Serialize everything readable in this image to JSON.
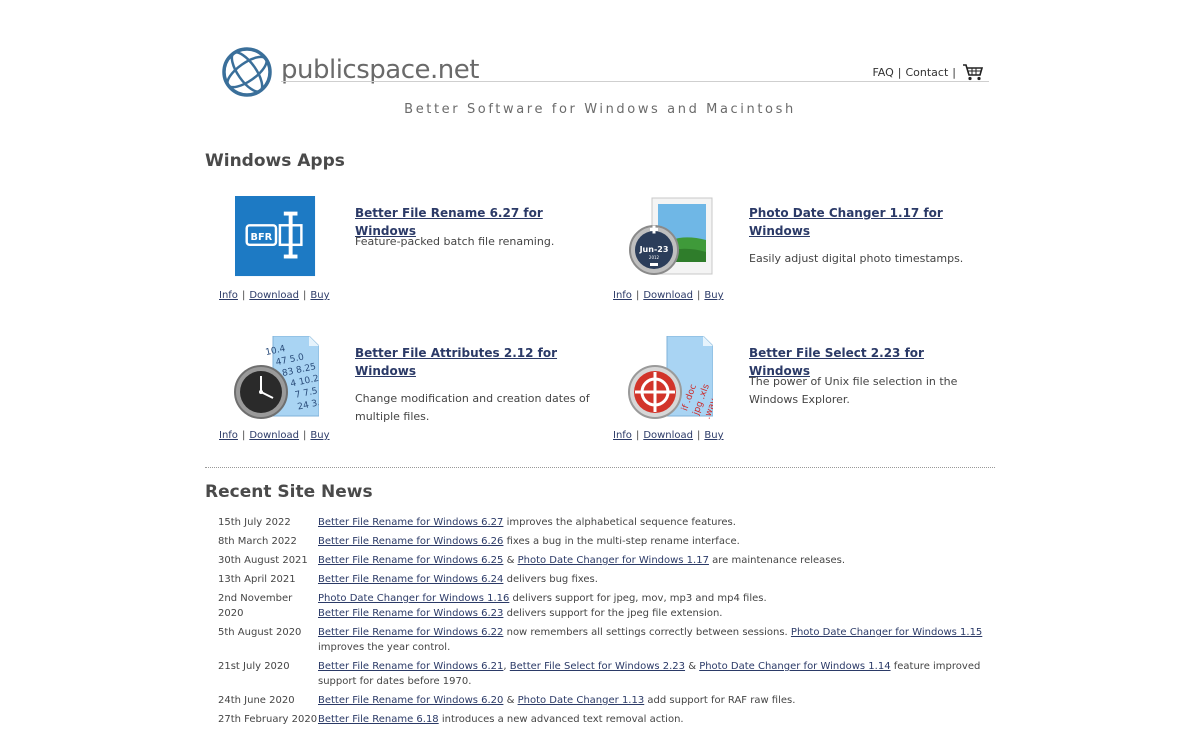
{
  "header": {
    "brand": "publicspace.net",
    "tagline": "Better Software for Windows and Macintosh",
    "nav": {
      "faq": "FAQ",
      "contact": "Contact",
      "sep": "|"
    }
  },
  "windows_apps": {
    "title": "Windows Apps",
    "apps": [
      {
        "name": "Better File Rename 6.27 for Windows",
        "desc": "Feature-packed batch file renaming.",
        "icon": "bfr-icon",
        "badge": "BFR"
      },
      {
        "name": "Photo Date Changer 1.17 for Windows",
        "desc": "Easily adjust digital photo timestamps.",
        "icon": "photo-date-changer-icon",
        "badge": "Jun-23",
        "badge_year": "2012"
      },
      {
        "name": "Better File Attributes 2.12 for Windows",
        "desc": "Change modification and creation dates of multiple files.",
        "icon": "clock-document-icon"
      },
      {
        "name": "Better File Select 2.23 for Windows",
        "desc": "The power of Unix file selection in the Windows Explorer.",
        "icon": "crosshair-document-icon"
      }
    ],
    "links": {
      "info": "Info",
      "download": "Download",
      "buy": "Buy",
      "sep": "|"
    }
  },
  "news": {
    "title": "Recent Site News",
    "items": [
      {
        "date": "15th July 2022",
        "segments": [
          {
            "link": "Better File Rename for Windows 6.27"
          },
          {
            "text": " improves the alphabetical sequence features."
          }
        ]
      },
      {
        "date": "8th March 2022",
        "segments": [
          {
            "link": "Better File Rename for Windows 6.26"
          },
          {
            "text": " fixes a bug in the multi-step rename interface."
          }
        ]
      },
      {
        "date": "30th August 2021",
        "segments": [
          {
            "link": "Better File Rename for Windows 6.25"
          },
          {
            "text": " & "
          },
          {
            "link": "Photo Date Changer for Windows 1.17"
          },
          {
            "text": " are maintenance releases."
          }
        ]
      },
      {
        "date": "13th April 2021",
        "segments": [
          {
            "link": "Better File Rename for Windows 6.24"
          },
          {
            "text": " delivers bug fixes."
          }
        ]
      },
      {
        "date": "2nd November 2020",
        "segments": [
          {
            "link": "Photo Date Changer for Windows 1.16"
          },
          {
            "text": " delivers support for jpeg, mov, mp3 and mp4 files."
          },
          {
            "br": true
          },
          {
            "link": "Better File Rename for Windows 6.23"
          },
          {
            "text": " delivers support for the jpeg file extension."
          }
        ]
      },
      {
        "date": "5th August 2020",
        "segments": [
          {
            "link": "Better File Rename for Windows 6.22"
          },
          {
            "text": " now remembers all settings correctly between sessions. "
          },
          {
            "link": "Photo Date Changer for Windows 1.15"
          },
          {
            "text": " improves the year control."
          }
        ]
      },
      {
        "date": "21st July 2020",
        "segments": [
          {
            "link": "Better File Rename for Windows 6.21"
          },
          {
            "text": ", "
          },
          {
            "link": "Better File Select for Windows 2.23"
          },
          {
            "text": " & "
          },
          {
            "link": "Photo Date Changer for Windows 1.14"
          },
          {
            "text": " feature improved support for dates before 1970."
          }
        ]
      },
      {
        "date": "24th June 2020",
        "segments": [
          {
            "link": "Better File Rename for Windows 6.20"
          },
          {
            "text": " & "
          },
          {
            "link": "Photo Date Changer 1.13"
          },
          {
            "text": " add support for RAF raw files."
          }
        ]
      },
      {
        "date": "27th February 2020",
        "segments": [
          {
            "link": "Better File Rename 6.18"
          },
          {
            "text": " introduces a new advanced text removal action."
          }
        ]
      }
    ]
  }
}
